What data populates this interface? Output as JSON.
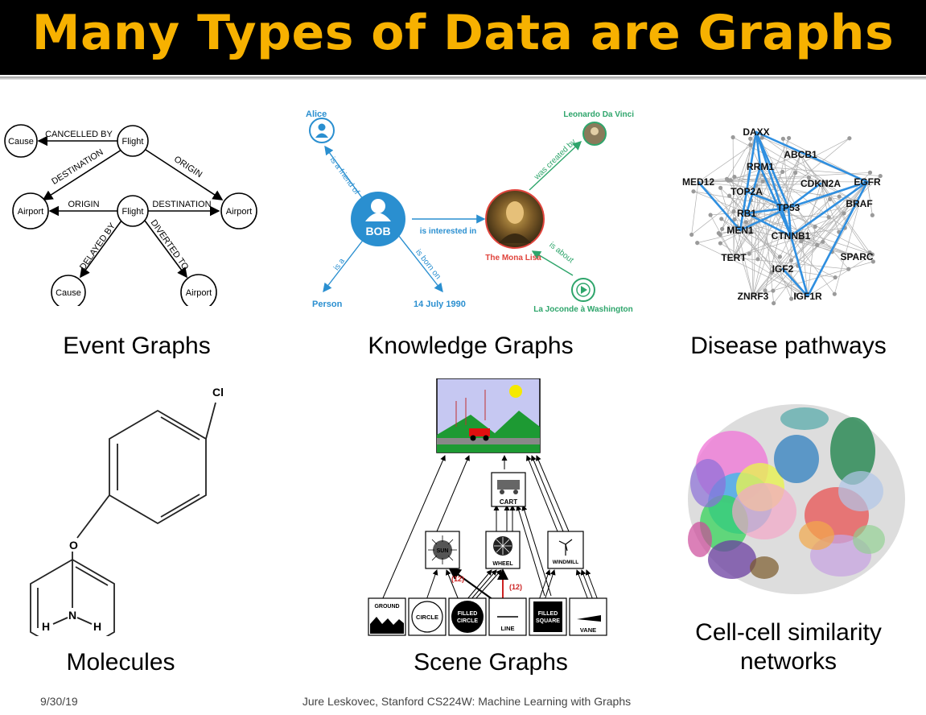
{
  "slide": {
    "title": "Many Types of Data are Graphs",
    "footer_date": "9/30/19",
    "footer_text": "Jure Leskovec, Stanford CS224W: Machine Learning with Graphs"
  },
  "panels": [
    {
      "caption": "Event Graphs"
    },
    {
      "caption": "Knowledge Graphs"
    },
    {
      "caption": "Disease pathways"
    },
    {
      "caption": "Molecules"
    },
    {
      "caption": "Scene Graphs"
    },
    {
      "caption": "Cell-cell similarity networks"
    }
  ],
  "event_graph": {
    "nodes": {
      "cause1": "Cause",
      "flight1": "Flight",
      "airport1": "Airport",
      "flight2": "Flight",
      "airport2": "Airport",
      "cause2": "Cause",
      "airport3": "Airport"
    },
    "edges": {
      "cancelled_by": "CANCELLED BY",
      "destination1": "DESTINATION",
      "origin1": "ORIGIN",
      "origin2": "ORIGIN",
      "destination2": "DESTINATION",
      "delayed_by": "DELAYED BY",
      "diverted_to": "DIVERTED TO"
    }
  },
  "knowledge_graph": {
    "nodes": {
      "alice": "Alice",
      "bob": "BOB",
      "person": "Person",
      "date": "14 July 1990",
      "leonardo": "Leonardo Da Vinci",
      "mona_lisa": "The Mona Lisa",
      "joconde": "La Joconde à Washington"
    },
    "edges": {
      "friend": "is a friend of",
      "interested": "is interested in",
      "is_a": "is a",
      "born": "is born on",
      "created": "was created by",
      "about": "is about"
    }
  },
  "disease_graph": {
    "genes": [
      "DAXX",
      "ABCB1",
      "RRM1",
      "MED12",
      "CDKN2A",
      "EGFR",
      "TOP2A",
      "TP53",
      "BRAF",
      "RB1",
      "MEN1",
      "CTNNB1",
      "TERT",
      "SPARC",
      "IGF2",
      "ZNRF3",
      "IGF1R"
    ]
  },
  "molecule": {
    "atoms": {
      "cl": "Cl",
      "o": "O",
      "n": "N",
      "h1": "H",
      "h2": "H"
    }
  },
  "scene_graph": {
    "nodes": {
      "cart": "CART",
      "sun": "SUN",
      "wheel": "WHEEL",
      "windmill": "WINDMILL",
      "ground": "GROUND",
      "circle": "CIRCLE",
      "filled_circle_1": "FILLED",
      "filled_circle_2": "CIRCLE",
      "line": "LINE",
      "filled_square_1": "FILLED",
      "filled_square_2": "SQUARE",
      "vane": "VANE"
    },
    "multiplicity": "(12)"
  },
  "colors": {
    "title": "#f7b100",
    "kg_blue": "#2a8fd0",
    "kg_green": "#2ea56b",
    "kg_red": "#e0443c",
    "pathway_blue": "#2f8fe0",
    "multiplicity_red": "#cc2222"
  }
}
